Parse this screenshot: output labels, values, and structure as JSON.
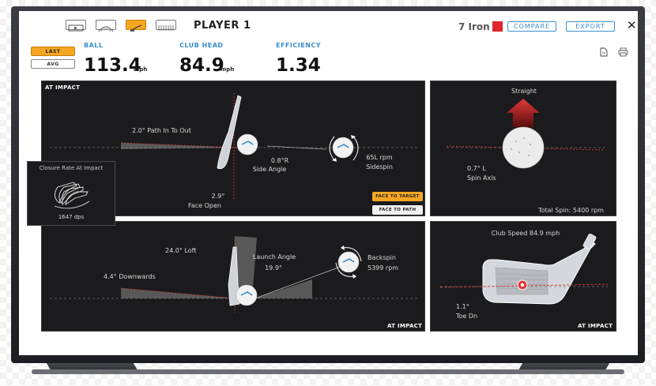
{
  "header": {
    "player": "PLAYER 1",
    "club": "7 Iron",
    "club_color": "#e0252f",
    "compare_label": "COMPARE",
    "export_label": "EXPORT",
    "close_label": "✕",
    "tool_icons": [
      "video-icon",
      "trajectory-icon",
      "club-view-icon",
      "data-table-icon"
    ],
    "active_tool": "club-view-icon"
  },
  "toggles": {
    "last": "LAST",
    "avg": "AVG"
  },
  "metrics": [
    {
      "label": "BALL",
      "value": "113.4",
      "unit": "mph"
    },
    {
      "label": "CLUB HEAD",
      "value": "84.9",
      "unit": "mph"
    },
    {
      "label": "EFFICIENCY",
      "value": "1.34",
      "unit": ""
    }
  ],
  "panels": {
    "top_view": {
      "title": "AT IMPACT",
      "path": "2.0° Path In To Out",
      "side_angle_value": "0.8°R",
      "side_angle_label": "Side Angle",
      "face_value": "2.9°",
      "face_label": "Face Open",
      "sidespin_value": "65L rpm",
      "sidespin_label": "Sidespin",
      "btn_face_target": "FACE TO TARGET",
      "btn_face_path": "FACE TO PATH"
    },
    "spin_axis": {
      "direction": "Straight",
      "spin_axis_value": "0.7° L",
      "spin_axis_label": "Spin Axis",
      "total_spin": "Total Spin: 5400 rpm"
    },
    "side_view": {
      "title": "AT IMPACT",
      "loft": "24.0° Loft",
      "downwards": "4.4° Downwards",
      "launch_label": "Launch Angle",
      "launch_value": "19.9°",
      "backspin_label": "Backspin",
      "backspin_value": "5399 rpm"
    },
    "face_view": {
      "title": "AT IMPACT",
      "club_speed": "Club Speed 84.9 mph",
      "toe_value": "1.1°",
      "toe_label": "Toe Dn"
    },
    "closure": {
      "title": "Closure Rate At Impact",
      "value": "1647 dps"
    }
  },
  "colors": {
    "accent": "#3a8fd0",
    "active": "#f6a623",
    "panel_bg": "#1b1b1d",
    "impact_line": "#e23b3b"
  }
}
